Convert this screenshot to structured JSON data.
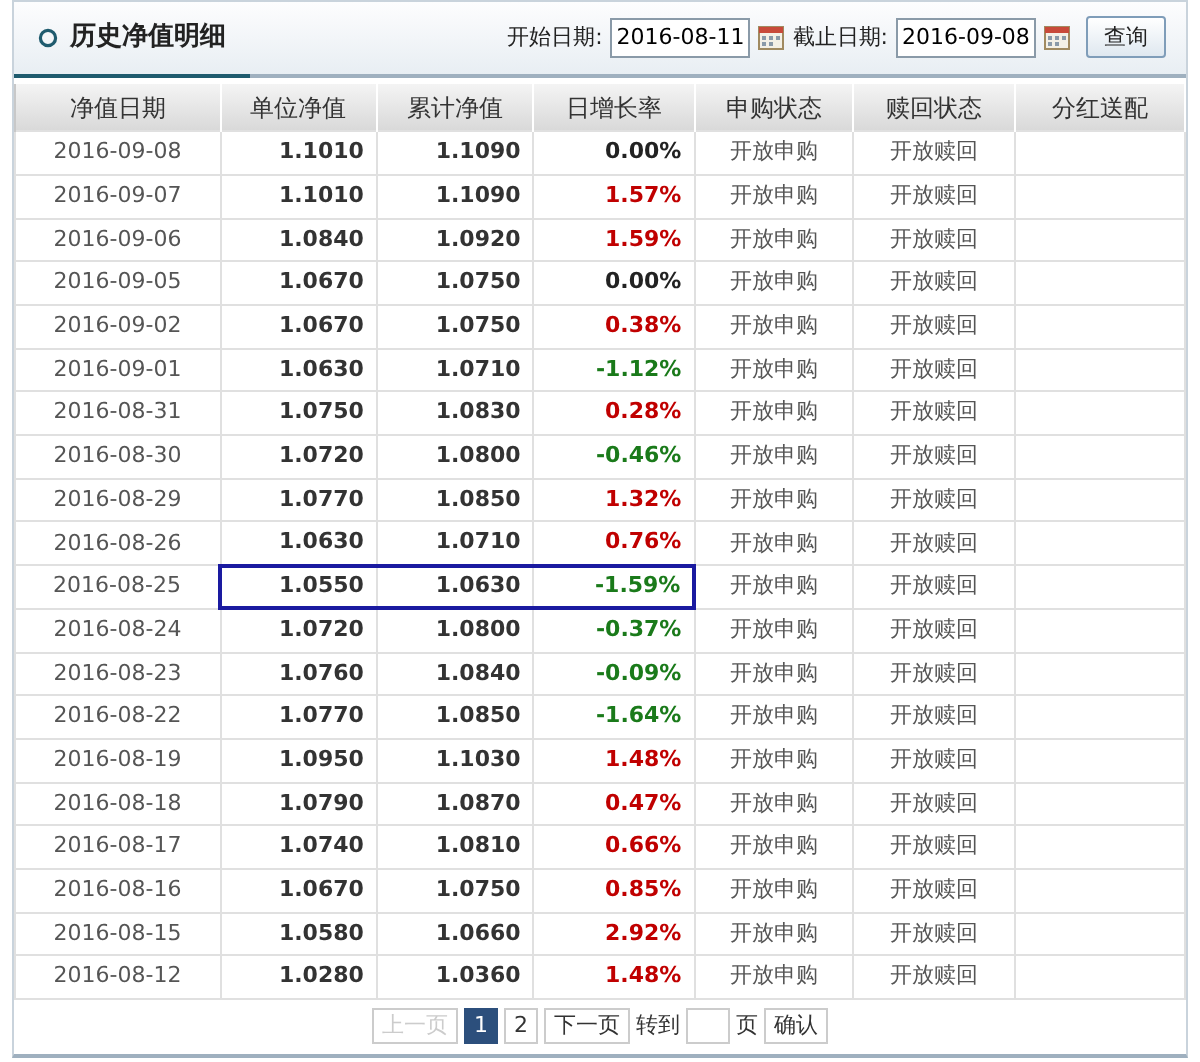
{
  "panel": {
    "title": "历史净值明细"
  },
  "filters": [
    {
      "label": "开始日期:",
      "value": "2016-08-11"
    },
    {
      "label": "截止日期:",
      "value": "2016-09-08"
    }
  ],
  "query_button": "查询",
  "table": {
    "columns": [
      "净值日期",
      "单位净值",
      "累计净值",
      "日增长率",
      "申购状态",
      "赎回状态",
      "分红送配"
    ],
    "rows": [
      {
        "date": "2016-09-08",
        "nav": "1.1010",
        "acc": "1.1090",
        "rate": "0.00%",
        "color": "#222222",
        "buy": "开放申购",
        "redeem": "开放赎回",
        "highlighted": false
      },
      {
        "date": "2016-09-07",
        "nav": "1.1010",
        "acc": "1.1090",
        "rate": "1.57%",
        "color": "#c00000",
        "buy": "开放申购",
        "redeem": "开放赎回",
        "highlighted": false
      },
      {
        "date": "2016-09-06",
        "nav": "1.0840",
        "acc": "1.0920",
        "rate": "1.59%",
        "color": "#c00000",
        "buy": "开放申购",
        "redeem": "开放赎回",
        "highlighted": false
      },
      {
        "date": "2016-09-05",
        "nav": "1.0670",
        "acc": "1.0750",
        "rate": "0.00%",
        "color": "#222222",
        "buy": "开放申购",
        "redeem": "开放赎回",
        "highlighted": false
      },
      {
        "date": "2016-09-02",
        "nav": "1.0670",
        "acc": "1.0750",
        "rate": "0.38%",
        "color": "#c00000",
        "buy": "开放申购",
        "redeem": "开放赎回",
        "highlighted": false
      },
      {
        "date": "2016-09-01",
        "nav": "1.0630",
        "acc": "1.0710",
        "rate": "-1.12%",
        "color": "#1a7a1a",
        "buy": "开放申购",
        "redeem": "开放赎回",
        "highlighted": false
      },
      {
        "date": "2016-08-31",
        "nav": "1.0750",
        "acc": "1.0830",
        "rate": "0.28%",
        "color": "#c00000",
        "buy": "开放申购",
        "redeem": "开放赎回",
        "highlighted": false
      },
      {
        "date": "2016-08-30",
        "nav": "1.0720",
        "acc": "1.0800",
        "rate": "-0.46%",
        "color": "#1a7a1a",
        "buy": "开放申购",
        "redeem": "开放赎回",
        "highlighted": false
      },
      {
        "date": "2016-08-29",
        "nav": "1.0770",
        "acc": "1.0850",
        "rate": "1.32%",
        "color": "#c00000",
        "buy": "开放申购",
        "redeem": "开放赎回",
        "highlighted": false
      },
      {
        "date": "2016-08-26",
        "nav": "1.0630",
        "acc": "1.0710",
        "rate": "0.76%",
        "color": "#c00000",
        "buy": "开放申购",
        "redeem": "开放赎回",
        "highlighted": false
      },
      {
        "date": "2016-08-25",
        "nav": "1.0550",
        "acc": "1.0630",
        "rate": "-1.59%",
        "color": "#1a7a1a",
        "buy": "开放申购",
        "redeem": "开放赎回",
        "highlighted": true
      },
      {
        "date": "2016-08-24",
        "nav": "1.0720",
        "acc": "1.0800",
        "rate": "-0.37%",
        "color": "#1a7a1a",
        "buy": "开放申购",
        "redeem": "开放赎回",
        "highlighted": false
      },
      {
        "date": "2016-08-23",
        "nav": "1.0760",
        "acc": "1.0840",
        "rate": "-0.09%",
        "color": "#1a7a1a",
        "buy": "开放申购",
        "redeem": "开放赎回",
        "highlighted": false
      },
      {
        "date": "2016-08-22",
        "nav": "1.0770",
        "acc": "1.0850",
        "rate": "-1.64%",
        "color": "#1a7a1a",
        "buy": "开放申购",
        "redeem": "开放赎回",
        "highlighted": false
      },
      {
        "date": "2016-08-19",
        "nav": "1.0950",
        "acc": "1.1030",
        "rate": "1.48%",
        "color": "#c00000",
        "buy": "开放申购",
        "redeem": "开放赎回",
        "highlighted": false
      },
      {
        "date": "2016-08-18",
        "nav": "1.0790",
        "acc": "1.0870",
        "rate": "0.47%",
        "color": "#c00000",
        "buy": "开放申购",
        "redeem": "开放赎回",
        "highlighted": false
      },
      {
        "date": "2016-08-17",
        "nav": "1.0740",
        "acc": "1.0810",
        "rate": "0.66%",
        "color": "#c00000",
        "buy": "开放申购",
        "redeem": "开放赎回",
        "highlighted": false
      },
      {
        "date": "2016-08-16",
        "nav": "1.0670",
        "acc": "1.0750",
        "rate": "0.85%",
        "color": "#c00000",
        "buy": "开放申购",
        "redeem": "开放赎回",
        "highlighted": false
      },
      {
        "date": "2016-08-15",
        "nav": "1.0580",
        "acc": "1.0660",
        "rate": "2.92%",
        "color": "#c00000",
        "buy": "开放申购",
        "redeem": "开放赎回",
        "highlighted": false
      },
      {
        "date": "2016-08-12",
        "nav": "1.0280",
        "acc": "1.0360",
        "rate": "1.48%",
        "color": "#c00000",
        "buy": "开放申购",
        "redeem": "开放赎回",
        "highlighted": false
      }
    ]
  },
  "pager": {
    "prev": {
      "label": "上一页",
      "disabled": true
    },
    "pages": [
      {
        "label": "1",
        "selected": true
      },
      {
        "label": "2",
        "selected": false
      }
    ],
    "next": {
      "label": "下一页",
      "disabled": false
    },
    "goto_label": "转到",
    "page_unit": "页",
    "confirm": "确认"
  }
}
